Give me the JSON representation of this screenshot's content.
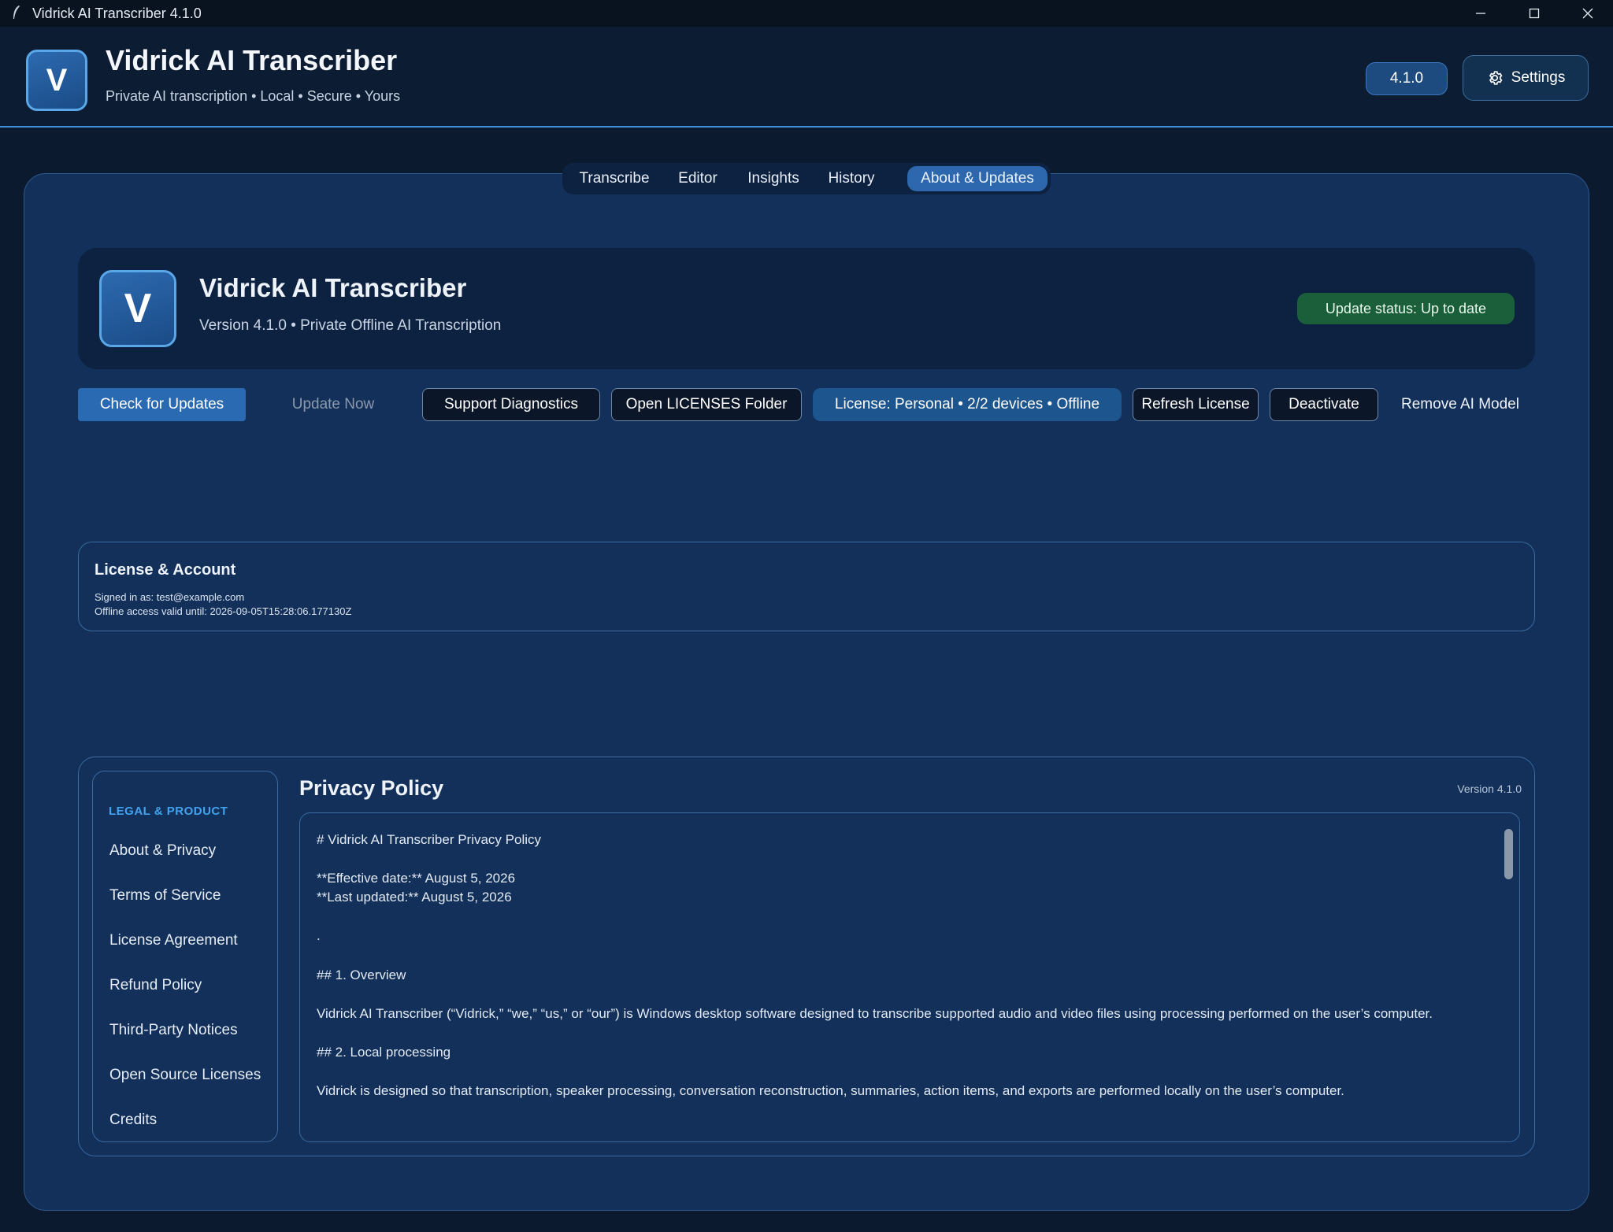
{
  "window": {
    "title": "Vidrick AI Transcriber 4.1.0"
  },
  "header": {
    "logo_letter": "V",
    "title": "Vidrick AI Transcriber",
    "subtitle": "Private AI transcription • Local • Secure • Yours",
    "version": "4.1.0",
    "settings_label": "Settings"
  },
  "tabs": [
    {
      "label": "Transcribe"
    },
    {
      "label": "Editor"
    },
    {
      "label": "Insights"
    },
    {
      "label": "History"
    },
    {
      "label": "About & Updates"
    }
  ],
  "about": {
    "logo_letter": "V",
    "title": "Vidrick AI Transcriber",
    "subtitle": "Version 4.1.0 • Private Offline AI Transcription",
    "update_status": "Update status: Up to date"
  },
  "actions": {
    "check_updates": "Check for Updates",
    "update_now": "Update Now",
    "support_diagnostics": "Support Diagnostics",
    "open_licenses": "Open LICENSES Folder",
    "license_status": "License: Personal • 2/2 devices • Offline",
    "refresh_license": "Refresh License",
    "deactivate": "Deactivate",
    "remove_model": "Remove AI Model"
  },
  "license": {
    "title": "License & Account",
    "signed_in": "Signed in as: test@example.com",
    "offline_valid": "Offline access valid until: 2026-09-05T15:28:06.177130Z"
  },
  "legal": {
    "heading": "LEGAL & PRODUCT",
    "items": [
      {
        "label": "About & Privacy"
      },
      {
        "label": "Terms of Service"
      },
      {
        "label": "License Agreement"
      },
      {
        "label": "Refund Policy"
      },
      {
        "label": "Third-Party Notices"
      },
      {
        "label": "Open Source Licenses"
      },
      {
        "label": "Credits"
      }
    ],
    "doc_title": "Privacy Policy",
    "doc_version": "Version 4.1.0",
    "doc_lines": [
      "# Vidrick AI Transcriber Privacy Policy",
      "**Effective date:** August 5, 2026",
      "**Last updated:** August 5, 2026",
      ".",
      "## 1. Overview",
      "Vidrick AI Transcriber (“Vidrick,” “we,” “us,” or “our”) is Windows desktop software designed to transcribe supported audio and video files using processing performed on the user’s computer.",
      "## 2. Local processing",
      "Vidrick is designed so that transcription, speaker processing, conversation reconstruction, summaries, action items, and exports are performed locally on the user’s computer."
    ]
  },
  "colors": {
    "accent": "#2d67ad",
    "panel": "#12305a",
    "success": "#1b5e3a"
  }
}
